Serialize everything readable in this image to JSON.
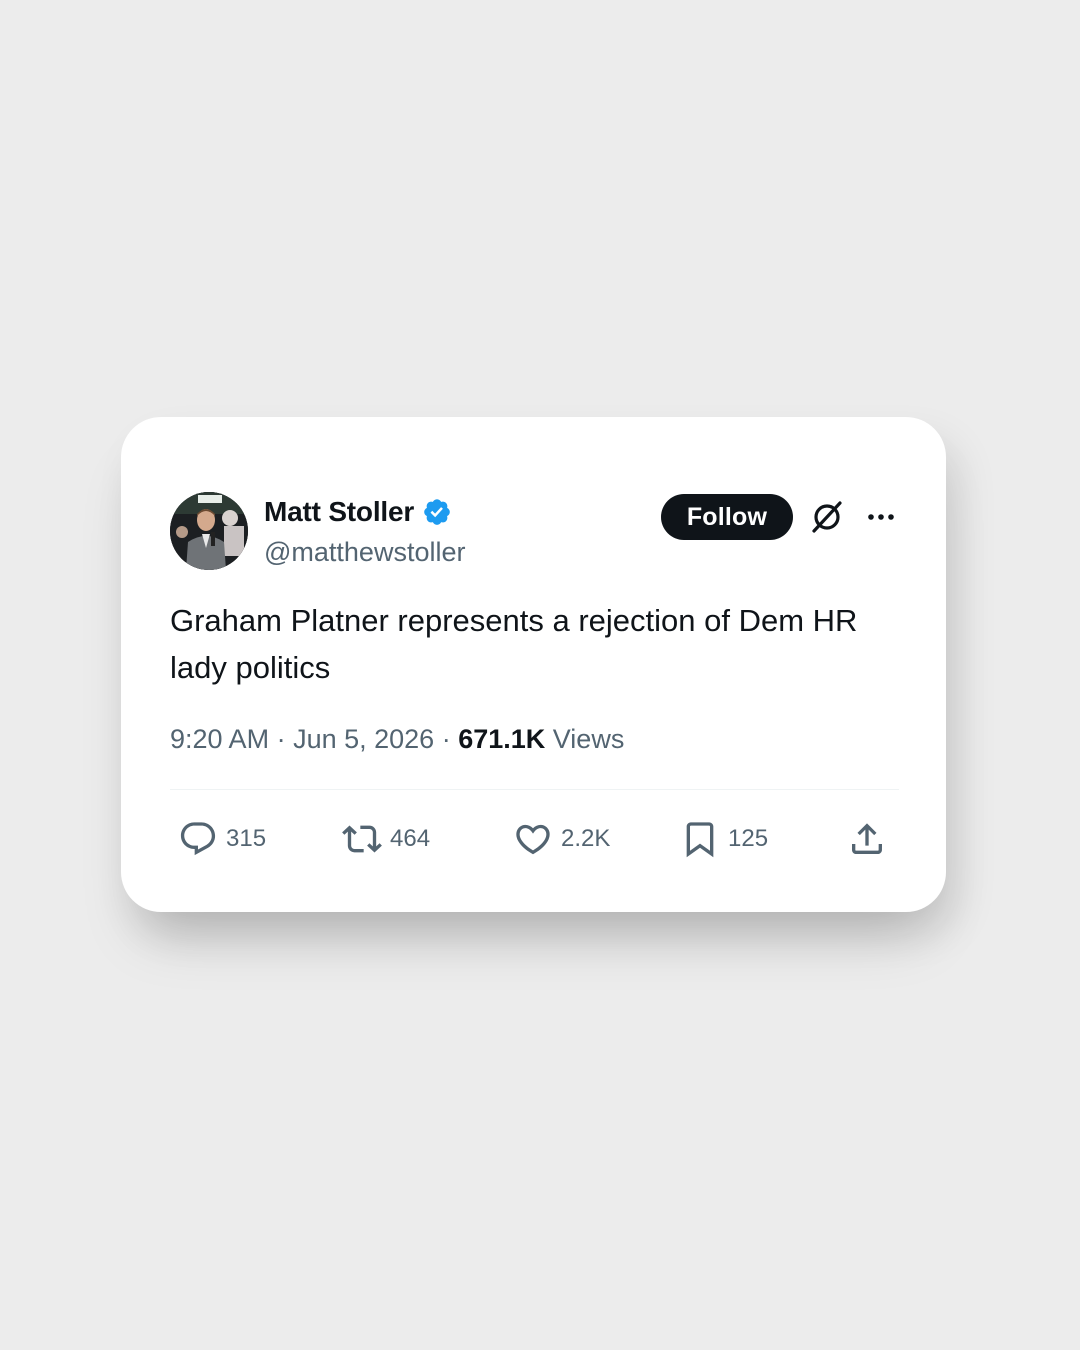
{
  "author": {
    "display_name": "Matt Stoller",
    "handle": "@matthewstoller",
    "verified": true
  },
  "header": {
    "follow_label": "Follow"
  },
  "tweet": {
    "text": "Graham Platner represents a rejection of Dem HR lady politics"
  },
  "meta": {
    "time": "9:20 AM",
    "separator": " · ",
    "date": "Jun 5, 2026",
    "views_count": "671.1K",
    "views_label": "Views"
  },
  "actions": {
    "replies": "315",
    "reposts": "464",
    "likes": "2.2K",
    "bookmarks": "125"
  },
  "colors": {
    "background": "#ececec",
    "card": "#ffffff",
    "text_primary": "#0f1419",
    "text_secondary": "#536471",
    "verified_blue": "#1d9bf0"
  },
  "icons": [
    "verified-badge-icon",
    "grok-icon",
    "more-icon",
    "reply-icon",
    "repost-icon",
    "like-icon",
    "bookmark-icon",
    "share-icon"
  ]
}
